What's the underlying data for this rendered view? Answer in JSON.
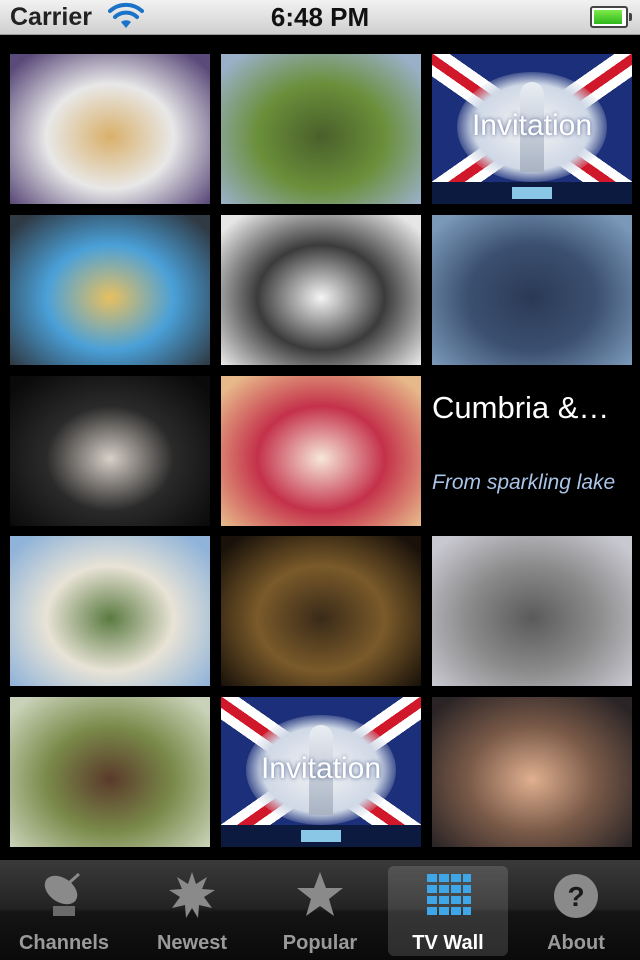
{
  "status_bar": {
    "carrier": "Carrier",
    "time": "6:48 PM",
    "battery_level": 1.0
  },
  "tiles": [
    {
      "row": 0,
      "col": 0,
      "kind": "photo",
      "colors": [
        "#5a4a7a",
        "#e8e8e8",
        "#d9b06a"
      ]
    },
    {
      "row": 0,
      "col": 1,
      "kind": "photo",
      "colors": [
        "#9ab0c8",
        "#6a8f3a",
        "#4a5f2a"
      ]
    },
    {
      "row": 0,
      "col": 2,
      "kind": "invitation",
      "title": "Invitation"
    },
    {
      "row": 1,
      "col": 0,
      "kind": "photo",
      "colors": [
        "#2f3a45",
        "#4aa0d8",
        "#e8c060"
      ]
    },
    {
      "row": 1,
      "col": 1,
      "kind": "photo",
      "colors": [
        "#e6e6e6",
        "#3b3b3b",
        "#f5f5f5"
      ]
    },
    {
      "row": 1,
      "col": 2,
      "kind": "photo",
      "colors": [
        "#7a98b8",
        "#3b4f70",
        "#2a3a55"
      ]
    },
    {
      "row": 2,
      "col": 0,
      "kind": "photo",
      "colors": [
        "#0a0a0a",
        "#2a2a2a",
        "#d8d0c8"
      ]
    },
    {
      "row": 2,
      "col": 1,
      "kind": "photo",
      "colors": [
        "#e7b98a",
        "#c4314a",
        "#f6e8d8"
      ]
    },
    {
      "row": 2,
      "col": 2,
      "kind": "text",
      "title": "Cumbria &…",
      "subtitle": "From sparkling lake"
    },
    {
      "row": 3,
      "col": 0,
      "kind": "photo",
      "colors": [
        "#8fb3d9",
        "#e8e3d6",
        "#5a7a40"
      ]
    },
    {
      "row": 3,
      "col": 1,
      "kind": "photo",
      "colors": [
        "#1a120a",
        "#7a5a2a",
        "#3a2a18"
      ]
    },
    {
      "row": 3,
      "col": 2,
      "kind": "photo",
      "colors": [
        "#c8c8d0",
        "#8a8a8a",
        "#5a5a5a"
      ]
    },
    {
      "row": 4,
      "col": 0,
      "kind": "photo",
      "colors": [
        "#c9d2b8",
        "#7a8a4a",
        "#5a3a2a"
      ]
    },
    {
      "row": 4,
      "col": 1,
      "kind": "invitation",
      "title": "Invitation"
    },
    {
      "row": 4,
      "col": 2,
      "kind": "photo",
      "colors": [
        "#2a2426",
        "#7a5a48",
        "#e0b090"
      ]
    }
  ],
  "tabs": [
    {
      "id": "channels",
      "label": "Channels",
      "icon": "satellite-dish-icon",
      "active": false
    },
    {
      "id": "newest",
      "label": "Newest",
      "icon": "starburst-icon",
      "active": false
    },
    {
      "id": "popular",
      "label": "Popular",
      "icon": "star-icon",
      "active": false
    },
    {
      "id": "tvwall",
      "label": "TV Wall",
      "icon": "grid-icon",
      "active": true
    },
    {
      "id": "about",
      "label": "About",
      "icon": "question-icon",
      "active": false
    }
  ],
  "colors": {
    "accent_grid_icon": "#3fa6e8",
    "tab_label_inactive": "#9a9a9a",
    "tab_label_active": "#ffffff"
  }
}
